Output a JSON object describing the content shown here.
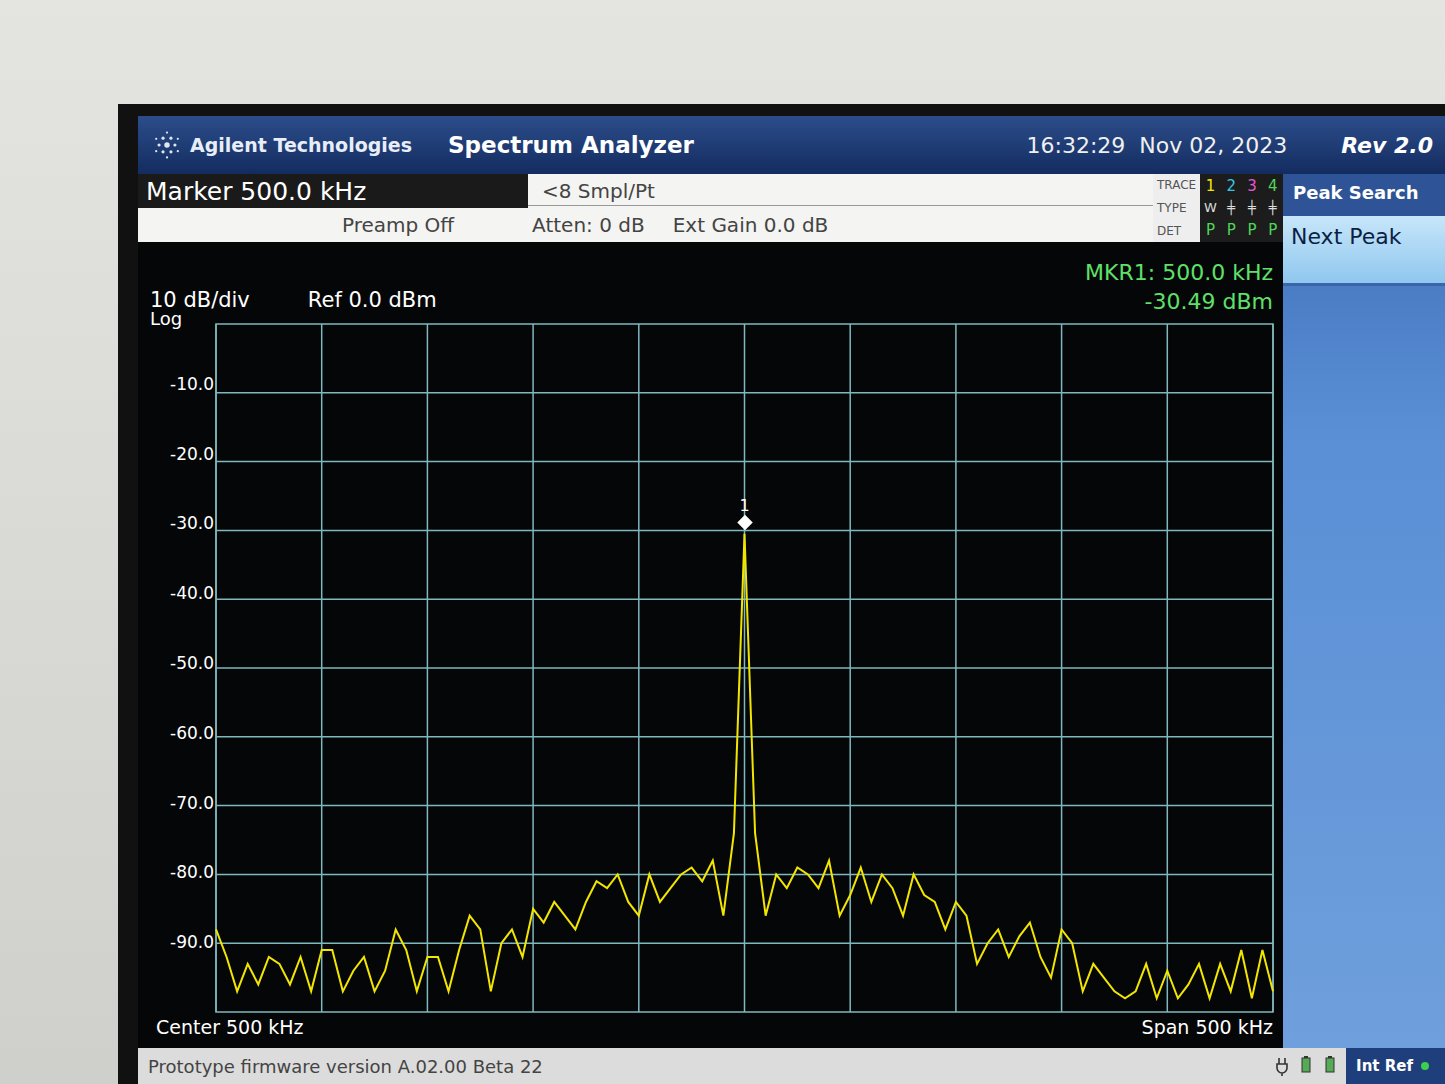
{
  "header": {
    "brand": "Agilent Technologies",
    "title": "Spectrum Analyzer",
    "time": "16:32:29",
    "date": "Nov 02, 2023",
    "revision": "Rev 2.0"
  },
  "settings": {
    "marker": "Marker 500.0 kHz",
    "samples": "<8 Smpl/Pt",
    "preamp": "Preamp Off",
    "atten": "Atten: 0 dB",
    "ext_gain": "Ext Gain 0.0 dB"
  },
  "trace_table": {
    "labels": [
      "TRACE",
      "TYPE",
      "DET"
    ],
    "traces": [
      {
        "number": "1",
        "color": "#f2e600",
        "type": "W",
        "det": "P"
      },
      {
        "number": "2",
        "color": "#37c6e8",
        "type": "╪",
        "det": "P"
      },
      {
        "number": "3",
        "color": "#e05ad0",
        "type": "╪",
        "det": "P"
      },
      {
        "number": "4",
        "color": "#4fd65a",
        "type": "╪",
        "det": "P"
      }
    ]
  },
  "softkeys": {
    "menu": "Peak Search",
    "keys": [
      {
        "label": "Next Peak",
        "selected": true
      }
    ]
  },
  "chart": {
    "scale": "10 dB/div",
    "ref": "Ref 0.0 dBm",
    "mode": "Log",
    "y_ticks": [
      "-10.0",
      "-20.0",
      "-30.0",
      "-40.0",
      "-50.0",
      "-60.0",
      "-70.0",
      "-80.0",
      "-90.0"
    ],
    "y_max": 0,
    "y_min": -100,
    "x_divisions": 10,
    "center": "Center 500 kHz",
    "span": "Span 500 kHz",
    "marker": {
      "label": "1",
      "index": 50,
      "readout_freq": "MKR1: 500.0 kHz",
      "readout_level": "-30.49 dBm"
    },
    "series": [
      {
        "name": "Trace 1",
        "color": "#f2e600",
        "values": [
          -88,
          -92,
          -97,
          -93,
          -96,
          -92,
          -93,
          -96,
          -92,
          -97,
          -91,
          -91,
          -97,
          -94,
          -92,
          -97,
          -94,
          -88,
          -91,
          -97,
          -92,
          -92,
          -97,
          -91,
          -86,
          -88,
          -97,
          -90,
          -88,
          -92,
          -85,
          -87,
          -84,
          -86,
          -88,
          -84,
          -81,
          -82,
          -80,
          -84,
          -86,
          -80,
          -84,
          -82,
          -80,
          -79,
          -81,
          -78,
          -86,
          -74,
          -30.49,
          -74,
          -86,
          -80,
          -82,
          -79,
          -80,
          -82,
          -78,
          -86,
          -83,
          -79,
          -84,
          -80,
          -82,
          -86,
          -80,
          -83,
          -84,
          -88,
          -84,
          -86,
          -93,
          -90,
          -88,
          -92,
          -89,
          -87,
          -92,
          -95,
          -88,
          -90,
          -97,
          -93,
          -95,
          -97,
          -98,
          -97,
          -93,
          -98,
          -94,
          -98,
          -96,
          -93,
          -98,
          -93,
          -97,
          -91,
          -98,
          -91,
          -97
        ]
      }
    ]
  },
  "status_bar": {
    "message": "Prototype firmware version A.02.00 Beta 22",
    "reference": "Int Ref",
    "reference_on": true
  }
}
